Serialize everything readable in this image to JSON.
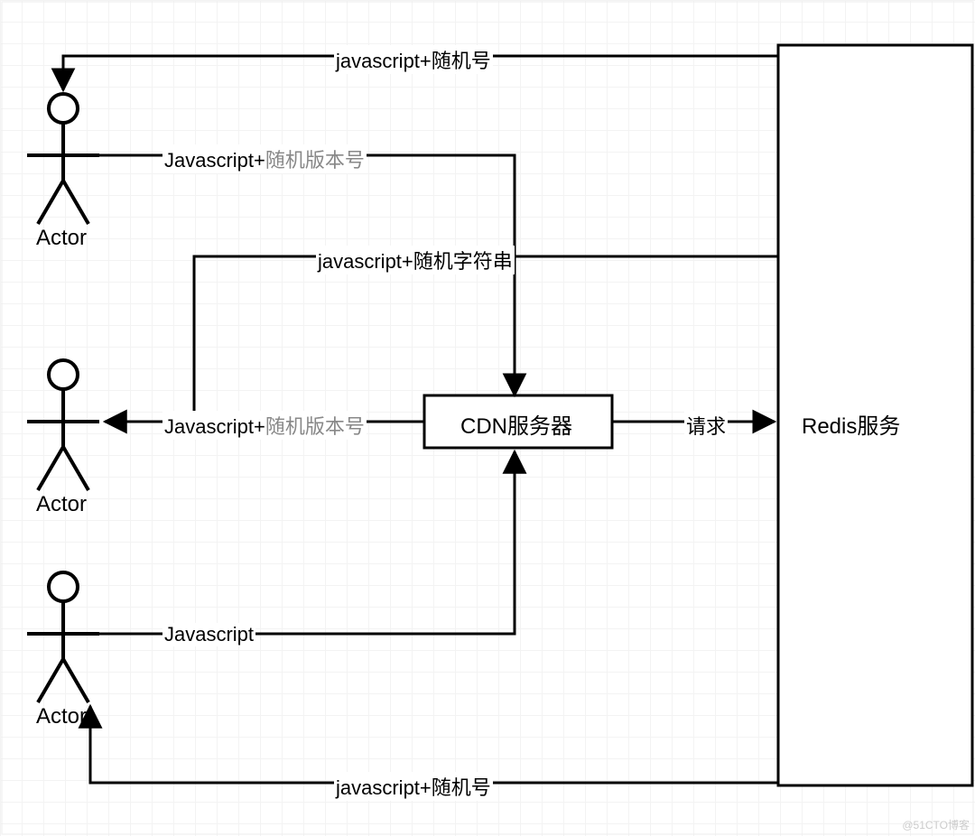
{
  "actors": {
    "a1": {
      "label": "Actor"
    },
    "a2": {
      "label": "Actor"
    },
    "a3": {
      "label": "Actor"
    }
  },
  "boxes": {
    "cdn": {
      "label": "CDN服务器"
    },
    "redis": {
      "label": "Redis服务"
    }
  },
  "edges": {
    "top_return": {
      "label": "javascript+随机号"
    },
    "a1_to_cdn_pre": "Javascript+",
    "a1_to_cdn_suf": "随机版本号",
    "redis_to_cdn": {
      "label": "javascript+随机字符串"
    },
    "cdn_to_a2_pre": "Javascript+",
    "cdn_to_a2_suf": "随机版本号",
    "cdn_to_redis": {
      "label": "请求"
    },
    "a3_to_cdn": {
      "label": "Javascript"
    },
    "bottom_return": {
      "label": "javascript+随机号"
    }
  },
  "watermark": "@51CTO博客"
}
